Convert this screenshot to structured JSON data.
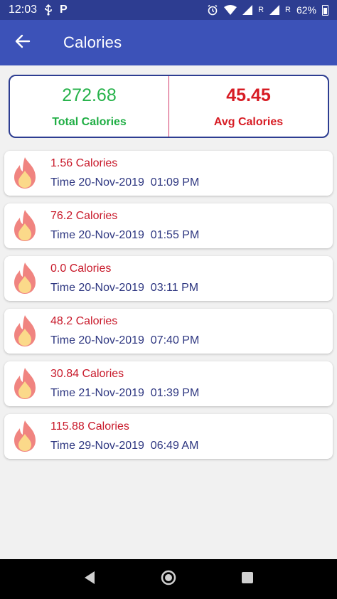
{
  "status_bar": {
    "time": "12:03",
    "parking_label": "P",
    "r1": "R",
    "r2": "R",
    "battery": "62%"
  },
  "app_bar": {
    "title": "Calories",
    "back_icon": "arrow-back-icon"
  },
  "summary": {
    "total_value": "272.68",
    "total_label": "Total Calories",
    "avg_value": "45.45",
    "avg_label": "Avg Calories"
  },
  "items": [
    {
      "calories": "1.56 Calories",
      "time": "Time 20-Nov-2019  01:09 PM"
    },
    {
      "calories": "76.2 Calories",
      "time": "Time 20-Nov-2019  01:55 PM"
    },
    {
      "calories": "0.0 Calories",
      "time": "Time 20-Nov-2019  03:11 PM"
    },
    {
      "calories": "48.2 Calories",
      "time": "Time 20-Nov-2019  07:40 PM"
    },
    {
      "calories": "30.84 Calories",
      "time": "Time 21-Nov-2019  01:39 PM"
    },
    {
      "calories": "115.88 Calories",
      "time": "Time 29-Nov-2019  06:49 AM"
    }
  ],
  "colors": {
    "status_bar": "#2d3d91",
    "app_bar": "#3c52b8",
    "total_green": "#26b24a",
    "avg_red": "#d71c24",
    "time_text": "#2d3680"
  },
  "icons": {
    "item_icon": "fire-icon",
    "nav_back": "nav-back-icon",
    "nav_home": "nav-home-icon",
    "nav_recents": "nav-recents-icon"
  }
}
